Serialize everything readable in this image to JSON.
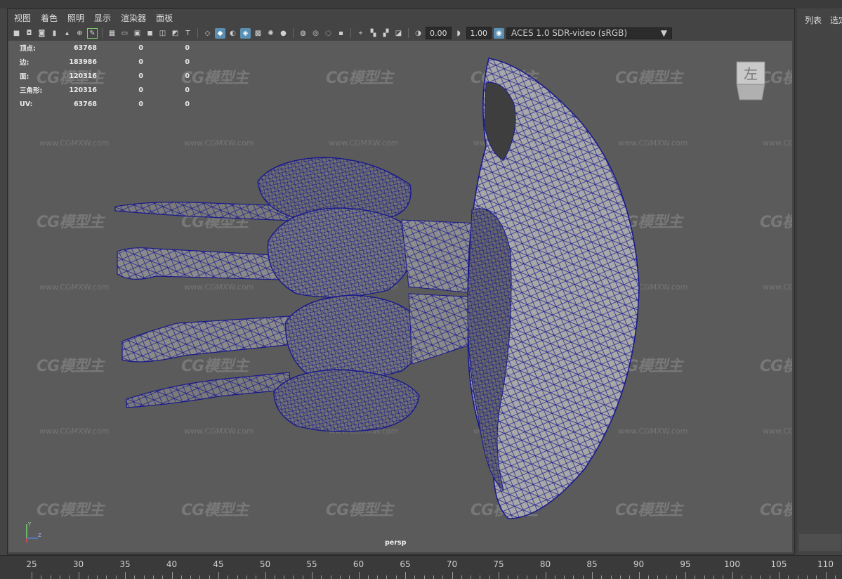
{
  "menu": [
    "视图",
    "着色",
    "照明",
    "显示",
    "渲染器",
    "面板"
  ],
  "toolbar": {
    "exposure": "0.00",
    "gamma": "1.00",
    "color_space": "ACES 1.0 SDR-video (sRGB)",
    "icons": [
      "camera-select-icon",
      "camera-attributes-icon",
      "bookmark-icon",
      "image-plane-icon",
      "2d-pan-zoom-icon",
      "grease-pencil-icon",
      "grid-icon",
      "film-gate-icon",
      "resolution-gate-icon",
      "gate-mask-icon",
      "field-chart-icon",
      "safe-action-icon",
      "safe-title-icon",
      "wireframe-icon",
      "smooth-shade-icon",
      "default-material-icon",
      "wireframe-on-shaded-icon",
      "xray-icon",
      "textured-icon",
      "use-lights-icon",
      "shadows-icon",
      "ambient-occlusion-icon",
      "motion-blur-icon",
      "anti-aliasing-icon",
      "depth-of-field-icon",
      "isolate-select-icon",
      "xray-joints-icon",
      "xray-active-icon",
      "backface-icon",
      "exposure-icon",
      "gamma-icon",
      "color-management-icon"
    ]
  },
  "hud": {
    "rows": [
      {
        "label": "顶点:",
        "v1": "63768",
        "v2": "0",
        "v3": "0"
      },
      {
        "label": "边:",
        "v1": "183986",
        "v2": "0",
        "v3": "0"
      },
      {
        "label": "面:",
        "v1": "120316",
        "v2": "0",
        "v3": "0"
      },
      {
        "label": "三角形:",
        "v1": "120316",
        "v2": "0",
        "v3": "0"
      },
      {
        "label": "UV:",
        "v1": "63768",
        "v2": "0",
        "v3": "0"
      }
    ]
  },
  "viewport": {
    "camera": "persp",
    "viewcube_label": "左",
    "axis_labels": {
      "y": "Y",
      "z": "Z"
    },
    "wireframe_color": "#1a1a8c",
    "background": "#5b5b5b"
  },
  "watermark": {
    "logo": "CG模型主",
    "url": "www.CGMXW.com"
  },
  "right_panel": {
    "tabs": [
      "列表",
      "选定"
    ]
  },
  "timeline": {
    "ticks": [
      "25",
      "30",
      "35",
      "40",
      "45",
      "50",
      "55",
      "60",
      "65",
      "70",
      "75",
      "80",
      "85",
      "90",
      "95",
      "100",
      "105",
      "110"
    ]
  }
}
